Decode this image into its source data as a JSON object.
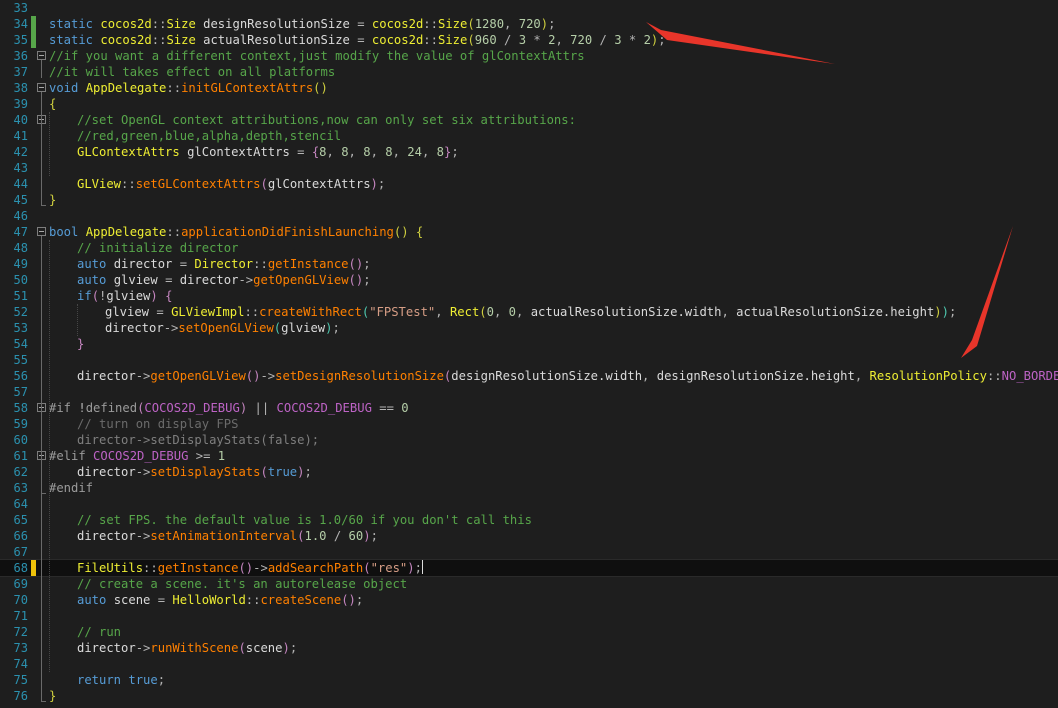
{
  "editor": {
    "language": "C++",
    "current_line": 68,
    "lines": [
      {
        "n": "33",
        "fold": "",
        "tokens": []
      },
      {
        "n": "34",
        "mark": "saved",
        "tokens": [
          [
            "kw",
            "static "
          ],
          [
            "ty",
            "cocos2d"
          ],
          [
            "op",
            "::"
          ],
          [
            "ty",
            "Size"
          ],
          [
            "id",
            " designResolutionSize "
          ],
          [
            "op",
            "= "
          ],
          [
            "ty",
            "cocos2d"
          ],
          [
            "op",
            "::"
          ],
          [
            "ty",
            "Size"
          ],
          [
            "p1",
            "("
          ],
          [
            "nu",
            "1280"
          ],
          [
            "op",
            ", "
          ],
          [
            "nu",
            "720"
          ],
          [
            "p1",
            ")"
          ],
          [
            "op",
            ";"
          ]
        ]
      },
      {
        "n": "35",
        "mark": "saved",
        "tokens": [
          [
            "kw",
            "static "
          ],
          [
            "ty",
            "cocos2d"
          ],
          [
            "op",
            "::"
          ],
          [
            "ty",
            "Size"
          ],
          [
            "id",
            " actualResolutionSize "
          ],
          [
            "op",
            "= "
          ],
          [
            "ty",
            "cocos2d"
          ],
          [
            "op",
            "::"
          ],
          [
            "ty",
            "Size"
          ],
          [
            "p1",
            "("
          ],
          [
            "nu",
            "960 "
          ],
          [
            "op",
            "/ "
          ],
          [
            "nu",
            "3 "
          ],
          [
            "op",
            "* "
          ],
          [
            "nu",
            "2"
          ],
          [
            "op",
            ", "
          ],
          [
            "nu",
            "720 "
          ],
          [
            "op",
            "/ "
          ],
          [
            "nu",
            "3 "
          ],
          [
            "op",
            "* "
          ],
          [
            "nu",
            "2"
          ],
          [
            "p1",
            ")"
          ],
          [
            "op",
            ";"
          ]
        ]
      },
      {
        "n": "36",
        "fold": "box",
        "tokens": [
          [
            "cm",
            "//if you want a different context,just modify the value of glContextAttrs"
          ]
        ]
      },
      {
        "n": "37",
        "tokens": [
          [
            "cm",
            "//it will takes effect on all platforms"
          ]
        ]
      },
      {
        "n": "38",
        "fold": "box",
        "tokens": [
          [
            "kw",
            "void "
          ],
          [
            "ty",
            "AppDelegate"
          ],
          [
            "op",
            "::"
          ],
          [
            "fn",
            "initGLContextAttrs"
          ],
          [
            "p1",
            "()"
          ]
        ]
      },
      {
        "n": "39",
        "tokens": [
          [
            "p1",
            "{"
          ]
        ]
      },
      {
        "n": "40",
        "fold": "box",
        "indent": 1,
        "tokens": [
          [
            "cm",
            "//set OpenGL context attributions,now can only set six attributions:"
          ]
        ]
      },
      {
        "n": "41",
        "indent": 1,
        "tokens": [
          [
            "cm",
            "//red,green,blue,alpha,depth,stencil"
          ]
        ]
      },
      {
        "n": "42",
        "indent": 1,
        "tokens": [
          [
            "ty",
            "GLContextAttrs"
          ],
          [
            "id",
            " glContextAttrs "
          ],
          [
            "op",
            "= "
          ],
          [
            "p2",
            "{"
          ],
          [
            "nu",
            "8"
          ],
          [
            "op",
            ", "
          ],
          [
            "nu",
            "8"
          ],
          [
            "op",
            ", "
          ],
          [
            "nu",
            "8"
          ],
          [
            "op",
            ", "
          ],
          [
            "nu",
            "8"
          ],
          [
            "op",
            ", "
          ],
          [
            "nu",
            "24"
          ],
          [
            "op",
            ", "
          ],
          [
            "nu",
            "8"
          ],
          [
            "p2",
            "}"
          ],
          [
            "op",
            ";"
          ]
        ]
      },
      {
        "n": "43",
        "tokens": []
      },
      {
        "n": "44",
        "indent": 1,
        "tokens": [
          [
            "ty",
            "GLView"
          ],
          [
            "op",
            "::"
          ],
          [
            "fn",
            "setGLContextAttrs"
          ],
          [
            "p2",
            "("
          ],
          [
            "id",
            "glContextAttrs"
          ],
          [
            "p2",
            ")"
          ],
          [
            "op",
            ";"
          ]
        ]
      },
      {
        "n": "45",
        "fold": "end",
        "tokens": [
          [
            "p1",
            "}"
          ]
        ]
      },
      {
        "n": "46",
        "tokens": []
      },
      {
        "n": "47",
        "fold": "box",
        "tokens": [
          [
            "kw",
            "bool "
          ],
          [
            "ty",
            "AppDelegate"
          ],
          [
            "op",
            "::"
          ],
          [
            "fn",
            "applicationDidFinishLaunching"
          ],
          [
            "p1",
            "() "
          ],
          [
            "p1",
            "{"
          ]
        ]
      },
      {
        "n": "48",
        "indent": 1,
        "tokens": [
          [
            "cm",
            "// initialize director"
          ]
        ]
      },
      {
        "n": "49",
        "indent": 1,
        "tokens": [
          [
            "kw",
            "auto "
          ],
          [
            "id",
            "director "
          ],
          [
            "op",
            "= "
          ],
          [
            "ty",
            "Director"
          ],
          [
            "op",
            "::"
          ],
          [
            "fn",
            "getInstance"
          ],
          [
            "p2",
            "()"
          ],
          [
            "op",
            ";"
          ]
        ]
      },
      {
        "n": "50",
        "indent": 1,
        "tokens": [
          [
            "kw",
            "auto "
          ],
          [
            "id",
            "glview "
          ],
          [
            "op",
            "= "
          ],
          [
            "id",
            "director"
          ],
          [
            "op",
            "->"
          ],
          [
            "fn",
            "getOpenGLView"
          ],
          [
            "p2",
            "()"
          ],
          [
            "op",
            ";"
          ]
        ]
      },
      {
        "n": "51",
        "indent": 1,
        "tokens": [
          [
            "kw",
            "if"
          ],
          [
            "p2",
            "("
          ],
          [
            "op",
            "!"
          ],
          [
            "id",
            "glview"
          ],
          [
            "p2",
            ") "
          ],
          [
            "p2",
            "{"
          ]
        ]
      },
      {
        "n": "52",
        "indent": 2,
        "tokens": [
          [
            "id",
            "glview "
          ],
          [
            "op",
            "= "
          ],
          [
            "ty",
            "GLViewImpl"
          ],
          [
            "op",
            "::"
          ],
          [
            "fn",
            "createWithRect"
          ],
          [
            "p3",
            "("
          ],
          [
            "st",
            "\"FPSTest\""
          ],
          [
            "op",
            ", "
          ],
          [
            "ty",
            "Rect"
          ],
          [
            "p1",
            "("
          ],
          [
            "nu",
            "0"
          ],
          [
            "op",
            ", "
          ],
          [
            "nu",
            "0"
          ],
          [
            "op",
            ", "
          ],
          [
            "id",
            "actualResolutionSize.width"
          ],
          [
            "op",
            ", "
          ],
          [
            "id",
            "actualResolutionSize.height"
          ],
          [
            "p1",
            ")"
          ],
          [
            "p3",
            ")"
          ],
          [
            "op",
            ";"
          ]
        ]
      },
      {
        "n": "53",
        "indent": 2,
        "tokens": [
          [
            "id",
            "director"
          ],
          [
            "op",
            "->"
          ],
          [
            "fn",
            "setOpenGLView"
          ],
          [
            "p3",
            "("
          ],
          [
            "id",
            "glview"
          ],
          [
            "p3",
            ")"
          ],
          [
            "op",
            ";"
          ]
        ]
      },
      {
        "n": "54",
        "indent": 1,
        "tokens": [
          [
            "p2",
            "}"
          ]
        ]
      },
      {
        "n": "55",
        "tokens": []
      },
      {
        "n": "56",
        "indent": 1,
        "tokens": [
          [
            "id",
            "director"
          ],
          [
            "op",
            "->"
          ],
          [
            "fn",
            "getOpenGLView"
          ],
          [
            "p2",
            "()"
          ],
          [
            "op",
            "->"
          ],
          [
            "fn",
            "setDesignResolutionSize"
          ],
          [
            "p2",
            "("
          ],
          [
            "id",
            "designResolutionSize.width"
          ],
          [
            "op",
            ", "
          ],
          [
            "id",
            "designResolutionSize.height"
          ],
          [
            "op",
            ", "
          ],
          [
            "ty",
            "ResolutionPolicy"
          ],
          [
            "op",
            "::"
          ],
          [
            "mc",
            "NO_BORDER"
          ],
          [
            "p2",
            ")"
          ],
          [
            "op",
            ";"
          ]
        ]
      },
      {
        "n": "57",
        "tokens": []
      },
      {
        "n": "58",
        "fold": "box",
        "tokens": [
          [
            "pp",
            "#if "
          ],
          [
            "op",
            "!"
          ],
          [
            "pp",
            "defined"
          ],
          [
            "p2",
            "("
          ],
          [
            "mc",
            "COCOS2D_DEBUG"
          ],
          [
            "p2",
            ") "
          ],
          [
            "op",
            "|| "
          ],
          [
            "mc",
            "COCOS2D_DEBUG "
          ],
          [
            "op",
            "== "
          ],
          [
            "nu",
            "0"
          ]
        ]
      },
      {
        "n": "59",
        "indent": 1,
        "tokens": [
          [
            "dim",
            "// turn on display FPS"
          ]
        ]
      },
      {
        "n": "60",
        "indent": 1,
        "tokens": [
          [
            "dis",
            "director->setDisplayStats(false);"
          ]
        ]
      },
      {
        "n": "61",
        "fold": "box",
        "tokens": [
          [
            "pp",
            "#elif "
          ],
          [
            "mc",
            "COCOS2D_DEBUG "
          ],
          [
            "op",
            ">= "
          ],
          [
            "nu",
            "1"
          ]
        ]
      },
      {
        "n": "62",
        "indent": 1,
        "tokens": [
          [
            "id",
            "director"
          ],
          [
            "op",
            "->"
          ],
          [
            "fn",
            "setDisplayStats"
          ],
          [
            "p2",
            "("
          ],
          [
            "kw",
            "true"
          ],
          [
            "p2",
            ")"
          ],
          [
            "op",
            ";"
          ]
        ]
      },
      {
        "n": "63",
        "fold": "end",
        "tokens": [
          [
            "pp",
            "#endif"
          ]
        ]
      },
      {
        "n": "64",
        "tokens": []
      },
      {
        "n": "65",
        "indent": 1,
        "tokens": [
          [
            "cm",
            "// set FPS. the default value is 1.0/60 if you don't call this"
          ]
        ]
      },
      {
        "n": "66",
        "indent": 1,
        "tokens": [
          [
            "id",
            "director"
          ],
          [
            "op",
            "->"
          ],
          [
            "fn",
            "setAnimationInterval"
          ],
          [
            "p2",
            "("
          ],
          [
            "nu",
            "1.0 "
          ],
          [
            "op",
            "/ "
          ],
          [
            "nu",
            "60"
          ],
          [
            "p2",
            ")"
          ],
          [
            "op",
            ";"
          ]
        ]
      },
      {
        "n": "67",
        "tokens": []
      },
      {
        "n": "68",
        "mark": "unsaved",
        "indent": 1,
        "caret": true,
        "tokens": [
          [
            "ty",
            "FileUtils"
          ],
          [
            "op",
            "::"
          ],
          [
            "fn",
            "getInstance"
          ],
          [
            "p2",
            "()"
          ],
          [
            "op",
            "->"
          ],
          [
            "fn",
            "addSearchPath"
          ],
          [
            "p2",
            "("
          ],
          [
            "st",
            "\"res\""
          ],
          [
            "p2",
            ")"
          ],
          [
            "op",
            ";"
          ]
        ]
      },
      {
        "n": "69",
        "indent": 1,
        "tokens": [
          [
            "cm",
            "// create a scene. it's an autorelease object"
          ]
        ]
      },
      {
        "n": "70",
        "indent": 1,
        "tokens": [
          [
            "kw",
            "auto "
          ],
          [
            "id",
            "scene "
          ],
          [
            "op",
            "= "
          ],
          [
            "ty",
            "HelloWorld"
          ],
          [
            "op",
            "::"
          ],
          [
            "fn",
            "createScene"
          ],
          [
            "p2",
            "()"
          ],
          [
            "op",
            ";"
          ]
        ]
      },
      {
        "n": "71",
        "tokens": []
      },
      {
        "n": "72",
        "indent": 1,
        "tokens": [
          [
            "cm",
            "// run"
          ]
        ]
      },
      {
        "n": "73",
        "indent": 1,
        "tokens": [
          [
            "id",
            "director"
          ],
          [
            "op",
            "->"
          ],
          [
            "fn",
            "runWithScene"
          ],
          [
            "p2",
            "("
          ],
          [
            "id",
            "scene"
          ],
          [
            "p2",
            ")"
          ],
          [
            "op",
            ";"
          ]
        ]
      },
      {
        "n": "74",
        "tokens": []
      },
      {
        "n": "75",
        "indent": 1,
        "tokens": [
          [
            "kw",
            "return "
          ],
          [
            "kw",
            "true"
          ],
          [
            "op",
            ";"
          ]
        ]
      },
      {
        "n": "76",
        "fold": "end",
        "tokens": [
          [
            "p1",
            "}"
          ]
        ]
      }
    ]
  },
  "annotations": {
    "arrow_color": "#e8352a",
    "arrows": [
      "arrow-to-line-34-35",
      "arrow-to-no-border"
    ]
  }
}
